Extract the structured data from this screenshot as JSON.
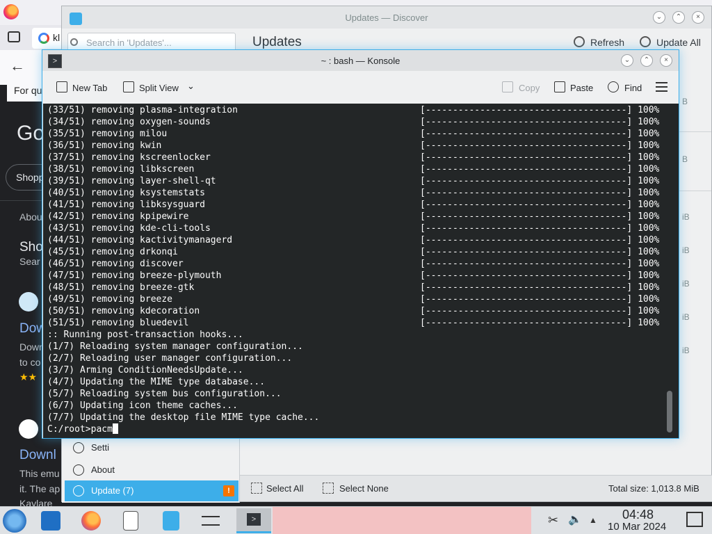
{
  "browser": {
    "tab_title": "kl",
    "quick_text": "For quic",
    "google_logo_fragment": "Go",
    "shopping_chip": "Shopp",
    "about_text": "Abou",
    "result1_heading": "Sho",
    "result1_sub": "Sear",
    "result2_link": "Dow",
    "result2_line1": "Down",
    "result2_line2": "to co",
    "rating_stars": "★★",
    "result3_link": "Downl",
    "result3_line1": "This emu",
    "result3_line2": "it. The ap",
    "result3_line3": "Kaylare"
  },
  "discover": {
    "title": "Updates — Discover",
    "search_placeholder": "Search in 'Updates'...",
    "page_heading": "Updates",
    "refresh_label": "Refresh",
    "update_all_label": "Update All",
    "sidebar_items": [
      {
        "label": "Setti"
      },
      {
        "label": "About"
      },
      {
        "label": "Update (7)"
      }
    ],
    "warning_badge": "!",
    "select_all_label": "Select All",
    "select_none_label": "Select None",
    "total_size": "Total size: 1,013.8 MiB",
    "row_sizes": [
      "B",
      "B",
      "iB",
      "iB",
      "iB",
      "iB",
      "iB"
    ]
  },
  "konsole": {
    "title": "~ : bash — Konsole",
    "toolbar": {
      "new_tab": "New Tab",
      "split_view": "Split View",
      "copy": "Copy",
      "paste": "Paste",
      "find": "Find"
    },
    "removal_lines": [
      "(33/51) removing plasma-integration",
      "(34/51) removing oxygen-sounds",
      "(35/51) removing milou",
      "(36/51) removing kwin",
      "(37/51) removing kscreenlocker",
      "(38/51) removing libkscreen",
      "(39/51) removing layer-shell-qt",
      "(40/51) removing ksystemstats",
      "(41/51) removing libksysguard",
      "(42/51) removing kpipewire",
      "(43/51) removing kde-cli-tools",
      "(44/51) removing kactivitymanagerd",
      "(45/51) removing drkonqi",
      "(46/51) removing discover",
      "(47/51) removing breeze-plymouth",
      "(48/51) removing breeze-gtk",
      "(49/51) removing breeze",
      "(50/51) removing kdecoration",
      "(51/51) removing bluedevil"
    ],
    "progress_bar": "[-------------------------------------] 100%",
    "hook_lines": [
      ":: Running post-transaction hooks...",
      "(1/7) Reloading system manager configuration...",
      "(2/7) Reloading user manager configuration...",
      "(3/7) Arming ConditionNeedsUpdate...",
      "(4/7) Updating the MIME type database...",
      "(5/7) Reloading system bus configuration...",
      "(6/7) Updating icon theme caches...",
      "(7/7) Updating the desktop file MIME type cache..."
    ],
    "prompt": "C:/root>",
    "typed": "pacm"
  },
  "taskbar": {
    "time": "04:48",
    "date": "10 Mar 2024"
  }
}
